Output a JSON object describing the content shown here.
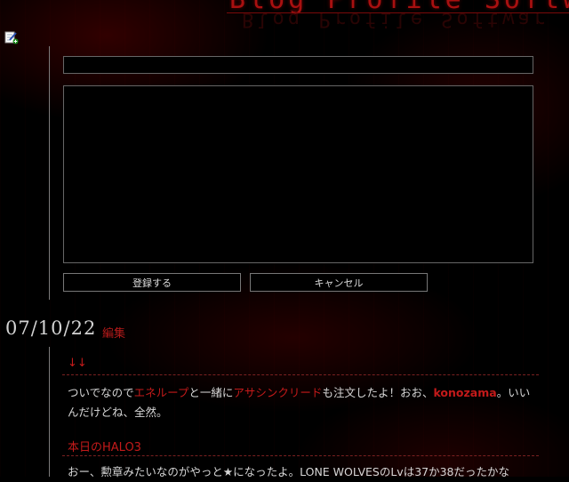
{
  "banner": {
    "text": "Blog Profile Software C",
    "reflection": "Blog Profile Software"
  },
  "editor": {
    "title_value": "",
    "body_value": "",
    "save_label": "登録する",
    "cancel_label": "キャンセル"
  },
  "entry": {
    "date": "07/10/22",
    "edit_label": "編集",
    "posts": [
      {
        "title": "↓↓",
        "body": {
          "t1": "ついでなので",
          "l1": "エネループ",
          "t2": "と一緒に",
          "l2": "アサシンクリード",
          "t3": "も注文したよ！おお、",
          "l3": "konozama",
          "t4": "。いいんだけどね、全然。"
        }
      },
      {
        "title": "本日のHALO3",
        "body": {
          "t1": "おー、勲章みたいなのがやっと★になったよ。LONE WOLVESのLvは37か38だったかな"
        }
      }
    ]
  },
  "colors": {
    "accent_red": "#c41a1a",
    "background": "#000000"
  },
  "icons": {
    "edit": "edit-note-icon"
  }
}
